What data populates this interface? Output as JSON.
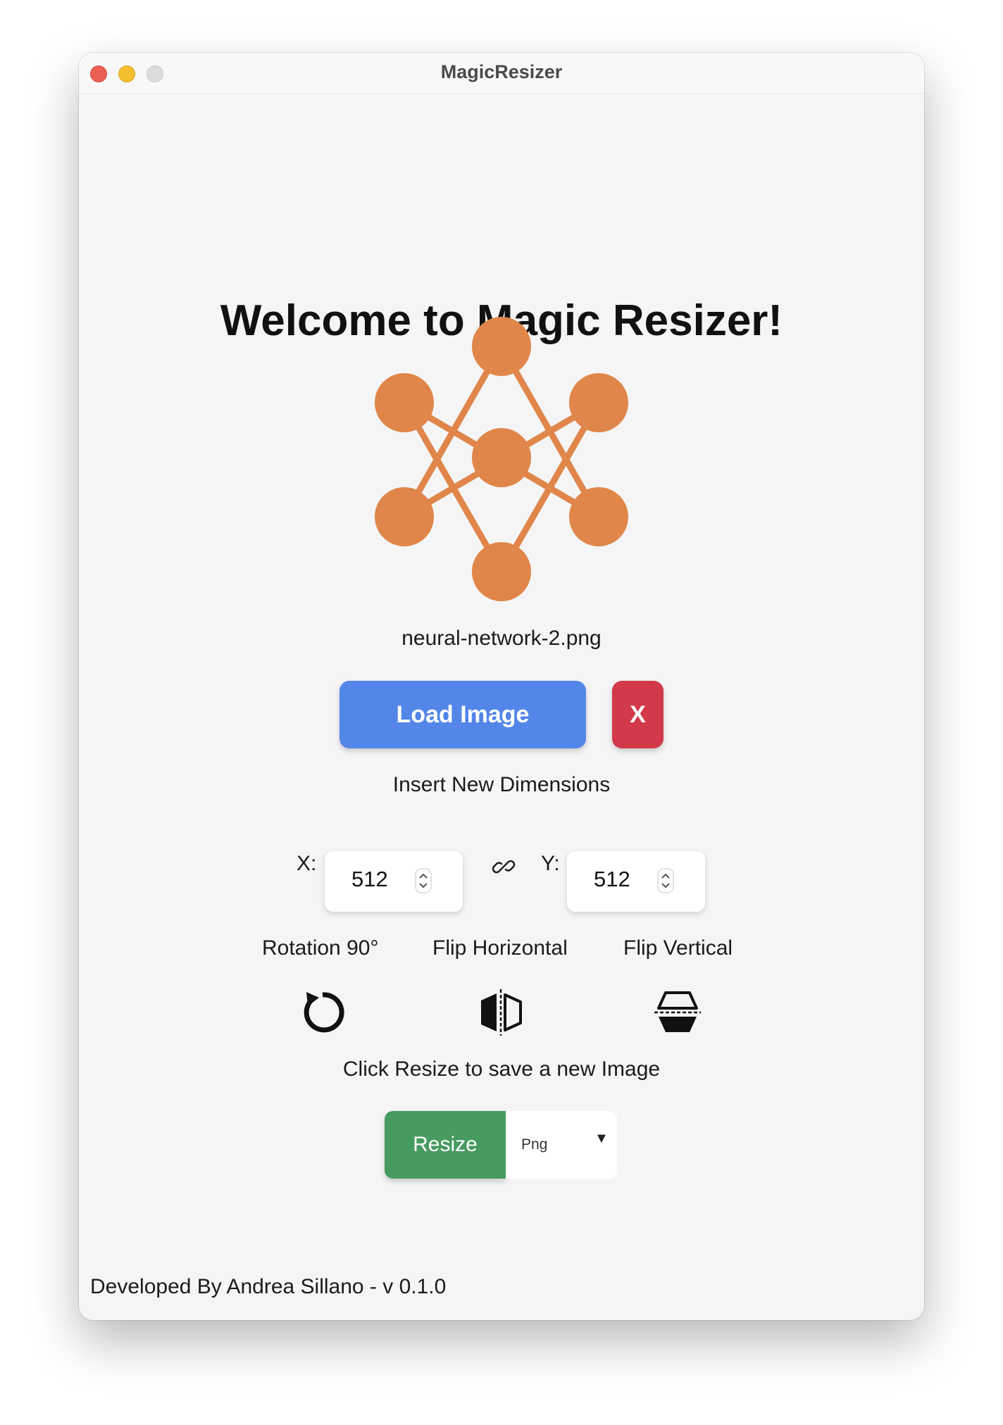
{
  "window": {
    "title": "MagicResizer"
  },
  "main": {
    "heading": "Welcome to Magic Resizer!",
    "filename": "neural-network-2.png",
    "load_button": "Load Image",
    "clear_button": "X",
    "insert_label": "Insert New Dimensions",
    "x_label": "X:",
    "x_value": "512",
    "y_label": "Y:",
    "y_value": "512",
    "operations": [
      {
        "label": "Rotation 90°",
        "icon": "rotate-icon"
      },
      {
        "label": "Flip Horizontal",
        "icon": "flip-horizontal-icon"
      },
      {
        "label": "Flip Vertical",
        "icon": "flip-vertical-icon"
      }
    ],
    "resize_hint": "Click Resize to save a new Image",
    "resize_button": "Resize",
    "format_selected": "Png"
  },
  "footer": {
    "text": "Developed By Andrea Sillano - v 0.1.0"
  },
  "colors": {
    "logo": "#e0864a",
    "load_button": "#5386e8",
    "clear_button": "#d23a4a",
    "resize_button": "#479a60",
    "background": "#f5f5f5"
  }
}
